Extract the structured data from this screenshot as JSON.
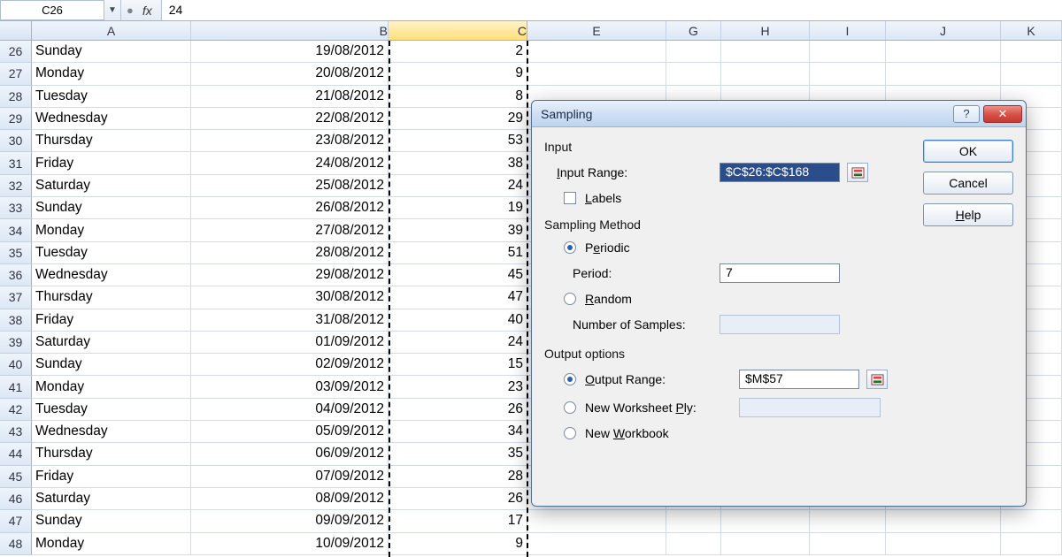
{
  "formula_bar": {
    "name_box": "C26",
    "fx_label": "fx",
    "formula": "24"
  },
  "columns": [
    {
      "id": "A",
      "label": "A",
      "w": "cA"
    },
    {
      "id": "B",
      "label": "B",
      "w": "cB"
    },
    {
      "id": "C",
      "label": "C",
      "w": "cC",
      "selected": true
    },
    {
      "id": "E",
      "label": "E",
      "w": "cE"
    },
    {
      "id": "G",
      "label": "G",
      "w": "cG"
    },
    {
      "id": "H",
      "label": "H",
      "w": "cH"
    },
    {
      "id": "I",
      "label": "I",
      "w": "cI"
    },
    {
      "id": "J",
      "label": "J",
      "w": "cJ"
    },
    {
      "id": "K",
      "label": "K",
      "w": "cK"
    }
  ],
  "rows": [
    {
      "n": 26,
      "A": "Sunday",
      "B": "19/08/2012",
      "C": "2"
    },
    {
      "n": 27,
      "A": "Monday",
      "B": "20/08/2012",
      "C": "9"
    },
    {
      "n": 28,
      "A": "Tuesday",
      "B": "21/08/2012",
      "C": "8"
    },
    {
      "n": 29,
      "A": "Wednesday",
      "B": "22/08/2012",
      "C": "29"
    },
    {
      "n": 30,
      "A": "Thursday",
      "B": "23/08/2012",
      "C": "53"
    },
    {
      "n": 31,
      "A": "Friday",
      "B": "24/08/2012",
      "C": "38"
    },
    {
      "n": 32,
      "A": "Saturday",
      "B": "25/08/2012",
      "C": "24"
    },
    {
      "n": 33,
      "A": "Sunday",
      "B": "26/08/2012",
      "C": "19"
    },
    {
      "n": 34,
      "A": "Monday",
      "B": "27/08/2012",
      "C": "39"
    },
    {
      "n": 35,
      "A": "Tuesday",
      "B": "28/08/2012",
      "C": "51"
    },
    {
      "n": 36,
      "A": "Wednesday",
      "B": "29/08/2012",
      "C": "45"
    },
    {
      "n": 37,
      "A": "Thursday",
      "B": "30/08/2012",
      "C": "47"
    },
    {
      "n": 38,
      "A": "Friday",
      "B": "31/08/2012",
      "C": "40"
    },
    {
      "n": 39,
      "A": "Saturday",
      "B": "01/09/2012",
      "C": "24"
    },
    {
      "n": 40,
      "A": "Sunday",
      "B": "02/09/2012",
      "C": "15"
    },
    {
      "n": 41,
      "A": "Monday",
      "B": "03/09/2012",
      "C": "23"
    },
    {
      "n": 42,
      "A": "Tuesday",
      "B": "04/09/2012",
      "C": "26"
    },
    {
      "n": 43,
      "A": "Wednesday",
      "B": "05/09/2012",
      "C": "34"
    },
    {
      "n": 44,
      "A": "Thursday",
      "B": "06/09/2012",
      "C": "35"
    },
    {
      "n": 45,
      "A": "Friday",
      "B": "07/09/2012",
      "C": "28"
    },
    {
      "n": 46,
      "A": "Saturday",
      "B": "08/09/2012",
      "C": "26"
    },
    {
      "n": 47,
      "A": "Sunday",
      "B": "09/09/2012",
      "C": "17"
    },
    {
      "n": 48,
      "A": "Monday",
      "B": "10/09/2012",
      "C": "9"
    }
  ],
  "dialog": {
    "title": "Sampling",
    "help_glyph": "?",
    "close_glyph": "✕",
    "input_label": "Input",
    "input_range_label": "Input Range:",
    "input_range_value": "$C$26:$C$168",
    "labels_label": "Labels",
    "method_label": "Sampling Method",
    "periodic_label": "Periodic",
    "period_label": "Period:",
    "period_value": "7",
    "random_label": "Random",
    "num_samples_label": "Number of Samples:",
    "output_label": "Output options",
    "output_range_label": "Output Range:",
    "output_range_value": "$M$57",
    "ws_ply_label": "New Worksheet Ply:",
    "wb_label": "New Workbook",
    "ok": "OK",
    "cancel": "Cancel",
    "help": "Help"
  }
}
